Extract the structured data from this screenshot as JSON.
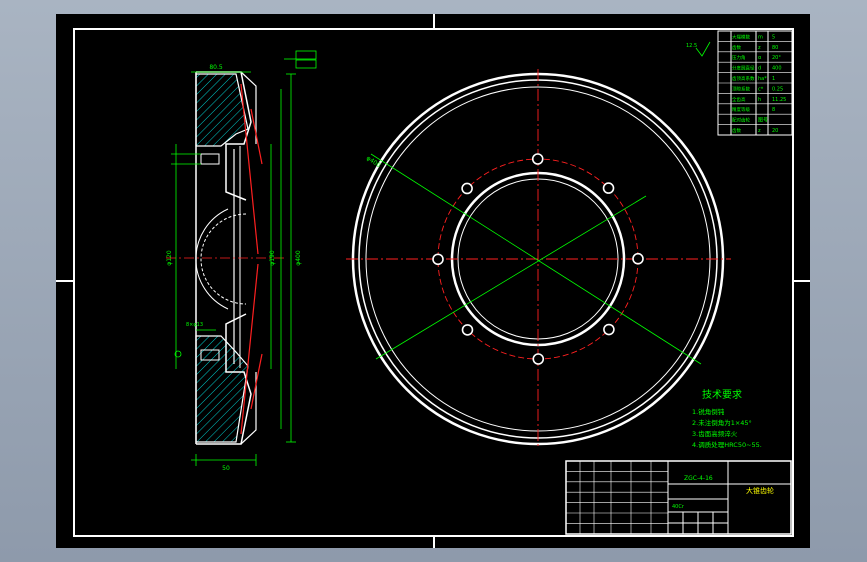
{
  "drawing": {
    "tech_title": "技术要求",
    "tech_notes": [
      "1.锐角倒钝",
      "2.未注倒角为1×45°",
      "3.齿面高频淬火",
      "4.调质处理HRC50~55."
    ],
    "title_block": {
      "part_name": "大锥齿轮",
      "code": "ZGC-4-16",
      "material": "40Cr"
    },
    "gear_params": {
      "labels": [
        "大端模数",
        "齿数",
        "压力角",
        "分度圆直径",
        "齿顶高系数",
        "顶隙系数",
        "全齿高",
        "精度等级",
        "配对齿轮",
        "齿数"
      ],
      "symbols": [
        "m",
        "z",
        "α",
        "d",
        "ha*",
        "c*",
        "h",
        "",
        "图号",
        "z"
      ],
      "values": [
        "5",
        "80",
        "20°",
        "400",
        "1",
        "0.25",
        "11.25",
        "8",
        "",
        "20"
      ]
    },
    "roughness": "12.5",
    "dims": {
      "left": [
        "φ400",
        "φ190",
        "φ120"
      ],
      "top": "80.5",
      "bottom": "50",
      "note": "8×φ13"
    }
  }
}
